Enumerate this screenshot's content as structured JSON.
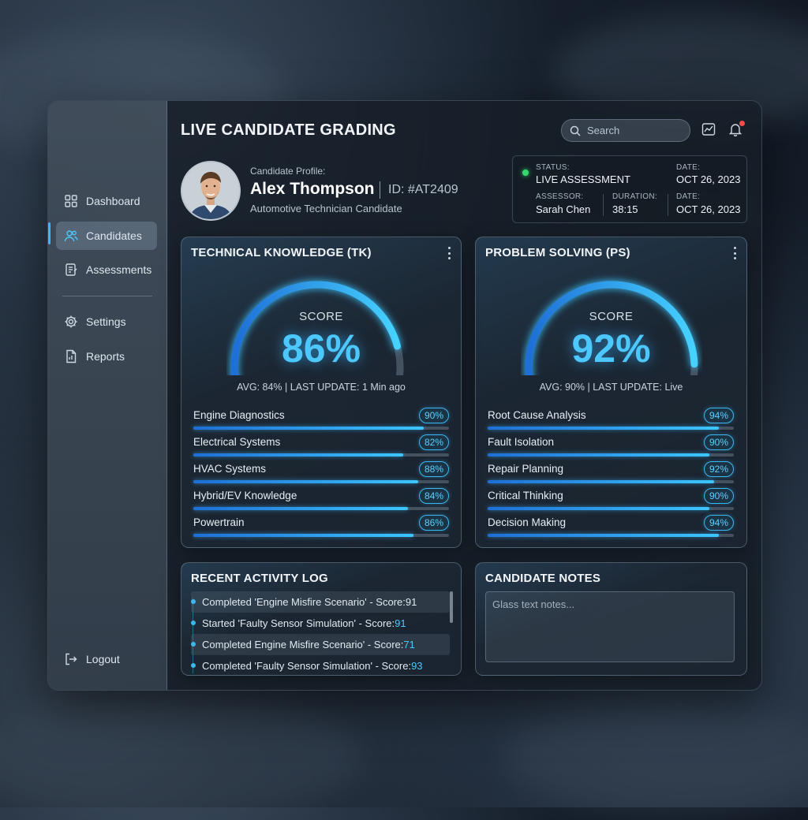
{
  "app": {
    "title": "LIVE CANDIDATE GRADING"
  },
  "sidebar": {
    "items": [
      {
        "label": "Dashboard",
        "icon": "grid-icon"
      },
      {
        "label": "Candidates",
        "icon": "users-icon",
        "active": true
      },
      {
        "label": "Assessments",
        "icon": "clipboard-icon"
      },
      {
        "label": "Settings",
        "icon": "gear-icon"
      },
      {
        "label": "Reports",
        "icon": "report-icon"
      }
    ],
    "logout_label": "Logout"
  },
  "header": {
    "search_placeholder": "Search"
  },
  "profile": {
    "label": "Candidate Profile:",
    "name": "Alex Thompson",
    "id": "ID: #AT2409",
    "role": "Automotive Technician Candidate"
  },
  "status": {
    "status_label": "STATUS:",
    "status_value": "LIVE ASSESSMENT",
    "date_label": "DATE:",
    "date_value": "OCT 26, 2023",
    "assessor_label": "ASSESSOR:",
    "assessor_value": "Sarah Chen",
    "duration_label": "DURATION:",
    "duration_value": "38:15",
    "date2_label": "DATE:",
    "date2_value": "OCT 26, 2023",
    "status_color": "#35d96b"
  },
  "tk": {
    "title": "TECHNICAL KNOWLEDGE (TK)",
    "score_label": "SCORE",
    "score_text": "86%",
    "score": 86,
    "avg_line": "AVG: 84% | LAST UPDATE: 1 Min ago",
    "skills": [
      {
        "name": "Engine Diagnostics",
        "badge": "90%",
        "value": 90
      },
      {
        "name": "Electrical Systems",
        "badge": "82%",
        "value": 82
      },
      {
        "name": "HVAC Systems",
        "badge": "88%",
        "value": 88
      },
      {
        "name": "Hybrid/EV Knowledge",
        "badge": "84%",
        "value": 84
      },
      {
        "name": "Powertrain",
        "badge": "86%",
        "value": 86
      }
    ]
  },
  "ps": {
    "title": "PROBLEM SOLVING (PS)",
    "score_label": "SCORE",
    "score_text": "92%",
    "score": 92,
    "avg_line": "AVG: 90% | LAST UPDATE: Live",
    "skills": [
      {
        "name": "Root Cause Analysis",
        "badge": "94%",
        "value": 94
      },
      {
        "name": "Fault Isolation",
        "badge": "90%",
        "value": 90
      },
      {
        "name": "Repair Planning",
        "badge": "92%",
        "value": 92
      },
      {
        "name": "Critical Thinking",
        "badge": "90%",
        "value": 90
      },
      {
        "name": "Decision Making",
        "badge": "94%",
        "value": 94
      }
    ]
  },
  "activity": {
    "title": "RECENT ACTIVITY LOG",
    "items": [
      {
        "text": "Completed 'Engine Misfire Scenario' - Score: ",
        "score": "91"
      },
      {
        "text": "Started 'Faulty Sensor Simulation' - Score: ",
        "score": "91"
      },
      {
        "text": "Completed Engine Misfire Scenario' - Score: ",
        "score": "71"
      },
      {
        "text": "Completed 'Faulty Sensor Simulation' - Score: ",
        "score": "93"
      }
    ]
  },
  "notes": {
    "title": "CANDIDATE NOTES",
    "placeholder": "Glass text notes..."
  },
  "colors": {
    "accent": "#3cc6ff",
    "notification": "#ff4a4a"
  }
}
